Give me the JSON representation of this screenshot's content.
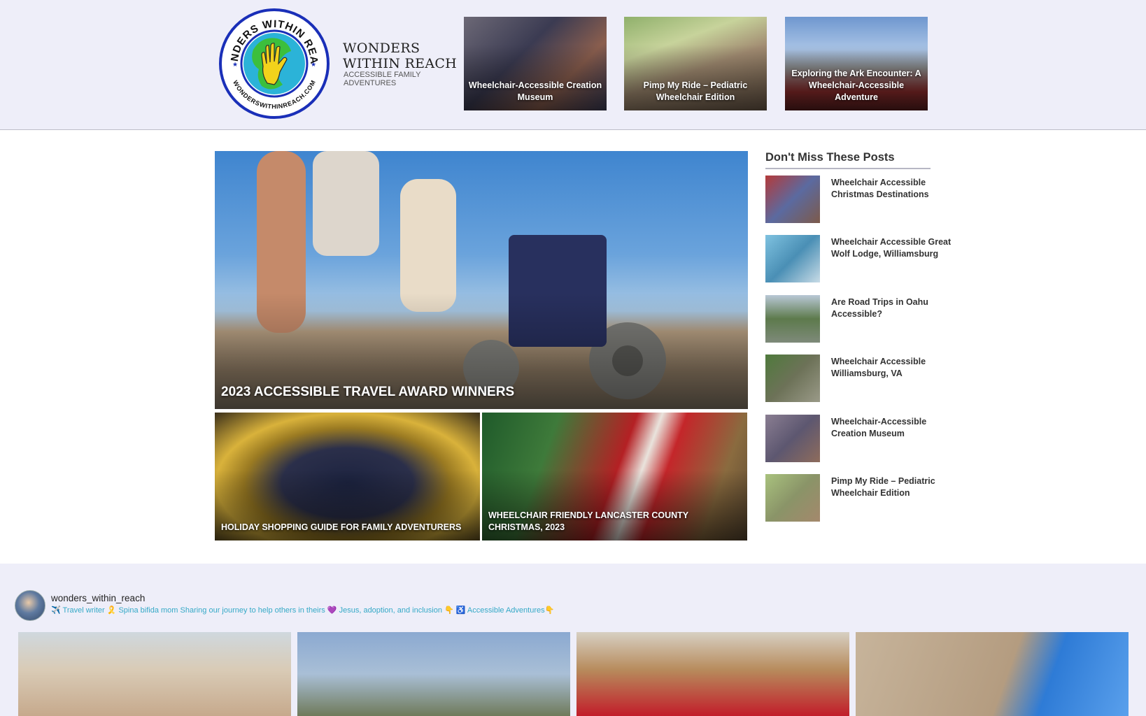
{
  "header": {
    "logo": {
      "ring_text_top": "WONDERS WITHIN REACH",
      "ring_text_bottom": "WONDERSWITHINREACH.COM",
      "colors": {
        "ring": "#1a2fb8",
        "globe_water": "#2bb3d8",
        "globe_land": "#3cbf3c",
        "hand": "#f2d21b"
      }
    },
    "site_name": "WONDERS WITHIN REACH",
    "tagline": "ACCESSIBLE FAMILY ADVENTURES",
    "featured": [
      {
        "title": "Wheelchair-Accessible Creation Museum"
      },
      {
        "title": "Pimp My Ride – Pediatric Wheelchair Edition"
      },
      {
        "title": "Exploring the Ark Encounter: A Wheelchair-Accessible Adventure"
      }
    ]
  },
  "main": {
    "hero": {
      "title": "2023 ACCESSIBLE TRAVEL AWARD WINNERS"
    },
    "cards": [
      {
        "title": "HOLIDAY SHOPPING GUIDE FOR FAMILY ADVENTURERS"
      },
      {
        "title": "WHEELCHAIR FRIENDLY LANCASTER COUNTY CHRISTMAS, 2023"
      }
    ]
  },
  "sidebar": {
    "title": "Don't Miss These Posts",
    "items": [
      {
        "label": "Wheelchair Accessible Christmas Destinations",
        "thumb": "#7d5a4a"
      },
      {
        "label": "Wheelchair Accessible Great Wolf Lodge, Williamsburg",
        "thumb": "#4a8fb5"
      },
      {
        "label": "Are Road Trips in Oahu Accessible?",
        "thumb": "#5d7a4c"
      },
      {
        "label": "Wheelchair Accessible Williamsburg, VA",
        "thumb": "#6d7258"
      },
      {
        "label": "Wheelchair-Accessible Creation Museum",
        "thumb": "#5d5770"
      },
      {
        "label": "Pimp My Ride – Pediatric Wheelchair Edition",
        "thumb": "#8a9468"
      }
    ]
  },
  "instagram": {
    "username": "wonders_within_reach",
    "bio": "✈️ Travel writer 🎗️ Spina bifida mom Sharing our journey to help others in theirs 💜 Jesus, adoption, and inclusion 👇 ♿ Accessible Adventures👇"
  }
}
